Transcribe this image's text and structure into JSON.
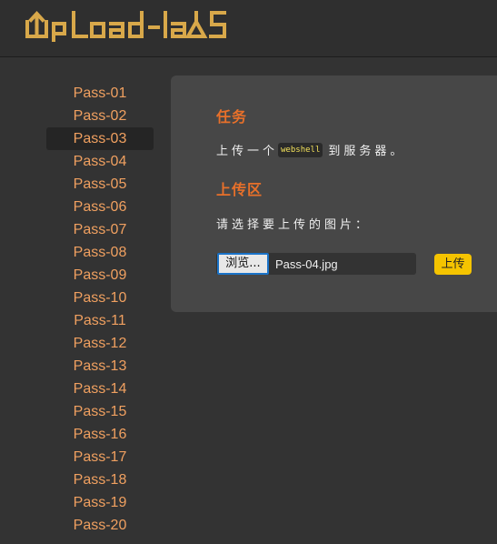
{
  "header": {
    "logo_text": "UpLoad-labS"
  },
  "sidebar": {
    "items": [
      {
        "label": "Pass-01"
      },
      {
        "label": "Pass-02"
      },
      {
        "label": "Pass-03"
      },
      {
        "label": "Pass-04"
      },
      {
        "label": "Pass-05"
      },
      {
        "label": "Pass-06"
      },
      {
        "label": "Pass-07"
      },
      {
        "label": "Pass-08"
      },
      {
        "label": "Pass-09"
      },
      {
        "label": "Pass-10"
      },
      {
        "label": "Pass-11"
      },
      {
        "label": "Pass-12"
      },
      {
        "label": "Pass-13"
      },
      {
        "label": "Pass-14"
      },
      {
        "label": "Pass-15"
      },
      {
        "label": "Pass-16"
      },
      {
        "label": "Pass-17"
      },
      {
        "label": "Pass-18"
      },
      {
        "label": "Pass-19"
      },
      {
        "label": "Pass-20"
      }
    ],
    "active_index": 2
  },
  "main": {
    "task_title": "任务",
    "task_prefix": "上传一个",
    "task_code": "webshell",
    "task_suffix": "到服务器。",
    "upload_title": "上传区",
    "select_label": "请选择要上传的图片：",
    "browse_label": "浏览...",
    "file_name": "Pass-04.jpg",
    "upload_button": "上传"
  },
  "colors": {
    "accent_orange": "#e8702a",
    "sidebar_link": "#f0a060",
    "upload_yellow": "#f5c400",
    "logo_gold": "#d8a84a"
  }
}
